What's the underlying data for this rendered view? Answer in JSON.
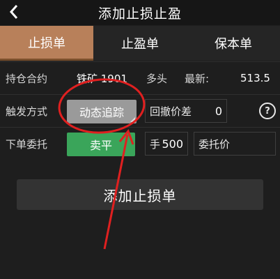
{
  "header": {
    "back_icon": "chevron-left-icon",
    "title": "添加止损止盈"
  },
  "tabs": [
    {
      "label": "止损单",
      "active": true
    },
    {
      "label": "止盈单",
      "active": false
    },
    {
      "label": "保本单",
      "active": false
    }
  ],
  "position": {
    "label": "持仓合约",
    "contract": "铁矿 1901",
    "direction": "多头",
    "latest_label": "最新:",
    "latest_value": "513.5"
  },
  "trigger": {
    "label": "触发方式",
    "mode_value": "动态追踪",
    "pullback_label": "回撤价差",
    "pullback_value": "0",
    "help_icon": "question-circle-icon"
  },
  "order": {
    "label": "下单委托",
    "side_button": "卖平",
    "qty_unit": "手",
    "qty_value": "500",
    "price_label": "委托价"
  },
  "add_button": "添加止损单",
  "colors": {
    "active_tab": "#b8805a",
    "sell_button": "#3aa55a",
    "annotation": "#e02020"
  }
}
